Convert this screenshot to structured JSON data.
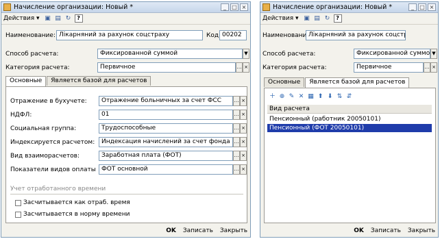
{
  "left": {
    "title": "Начисление организации: Новый *",
    "actions": "Действия ▾",
    "name_label": "Наименование:",
    "name_value": "Лікарняний за рахунок соцстраху",
    "code_label": "Код:",
    "code_value": "00202",
    "method_label": "Способ расчета:",
    "method_value": "Фиксированной суммой",
    "category_label": "Категория расчета:",
    "category_value": "Первичное",
    "tabs": [
      "Основные",
      "Является базой для расчетов"
    ],
    "fields": [
      {
        "label": "Отражение в бухучете:",
        "value": "Отражение больничных за счет ФСС"
      },
      {
        "label": "НДФЛ:",
        "value": "01"
      },
      {
        "label": "Социальная группа:",
        "value": "Трудоспособные"
      },
      {
        "label": "Индексируется расчетом:",
        "value": "Индексация начислений за счет фонда социа"
      },
      {
        "label": "Вид взаиморасчетов:",
        "value": "Заработная плата (ФОТ)"
      },
      {
        "label": "Показатели видов оплаты тр...",
        "value": "ФОТ основной"
      }
    ],
    "section_title": "Учет отработанного времени",
    "checkbox1": "Засчитывается как отраб. время",
    "checkbox2": "Засчитывается в норму времени",
    "ok": "OK",
    "save": "Записать",
    "close": "Закрыть"
  },
  "right": {
    "title": "Начисление организации: Новый *",
    "actions": "Действия ▾",
    "name_label": "Наименование:",
    "name_value": "Лікарняний за рахунок соцстраху",
    "method_label": "Способ расчета:",
    "method_value": "Фиксированной суммой",
    "category_label": "Категория расчета:",
    "category_value": "Первичное",
    "tabs": [
      "Основные",
      "Является базой для расчетов"
    ],
    "list_header": "Вид расчета",
    "rows": [
      "Пенсионный (работник 20050101)",
      "Пенсионный (ФОТ 20050101)"
    ],
    "ok": "OK",
    "save": "Записать",
    "close": "Закрыть"
  }
}
